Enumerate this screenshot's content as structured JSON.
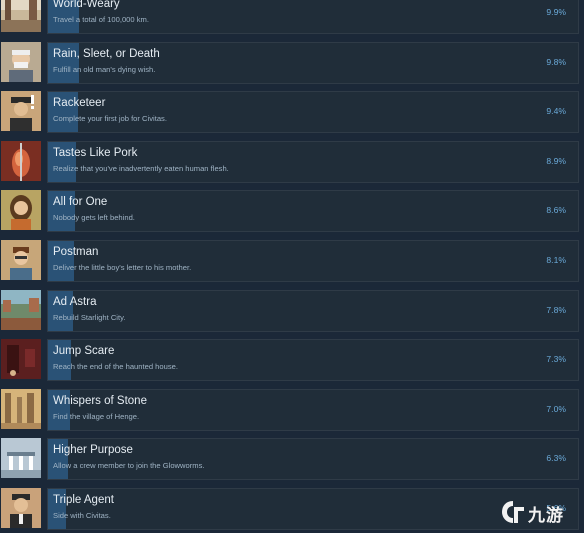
{
  "achievements": [
    {
      "name": "World-Weary",
      "description": "Travel a total of 100,000 km.",
      "percent": "9.9%",
      "fill": 0.099,
      "icon": "road-landscape-icon"
    },
    {
      "name": "Rain, Sleet, or Death",
      "description": "Fulfill an old man's dying wish.",
      "percent": "9.8%",
      "fill": 0.098,
      "icon": "old-man-portrait-icon"
    },
    {
      "name": "Racketeer",
      "description": "Complete your first job for Civitas.",
      "percent": "9.4%",
      "fill": 0.094,
      "icon": "gangster-portrait-icon"
    },
    {
      "name": "Tastes Like Pork",
      "description": "Realize that you've inadvertently eaten human flesh.",
      "percent": "8.9%",
      "fill": 0.089,
      "icon": "roast-meat-icon"
    },
    {
      "name": "All for One",
      "description": "Nobody gets left behind.",
      "percent": "8.6%",
      "fill": 0.086,
      "icon": "girl-portrait-icon"
    },
    {
      "name": "Postman",
      "description": "Deliver the little boy's letter to his mother.",
      "percent": "8.1%",
      "fill": 0.081,
      "icon": "boy-portrait-icon"
    },
    {
      "name": "Ad Astra",
      "description": "Rebuild Starlight City.",
      "percent": "7.8%",
      "fill": 0.078,
      "icon": "city-walls-icon"
    },
    {
      "name": "Jump Scare",
      "description": "Reach the end of the haunted house.",
      "percent": "7.3%",
      "fill": 0.073,
      "icon": "haunted-room-icon"
    },
    {
      "name": "Whispers of Stone",
      "description": "Find the village of Henge.",
      "percent": "7.0%",
      "fill": 0.07,
      "icon": "stone-village-icon"
    },
    {
      "name": "Higher Purpose",
      "description": "Allow a crew member to join the Glowworms.",
      "percent": "6.3%",
      "fill": 0.063,
      "icon": "shrine-icon"
    },
    {
      "name": "Triple Agent",
      "description": "Side with Civitas.",
      "percent": "5.6%",
      "fill": 0.056,
      "icon": "agent-portrait-icon"
    }
  ],
  "watermark": {
    "text": "九游"
  }
}
